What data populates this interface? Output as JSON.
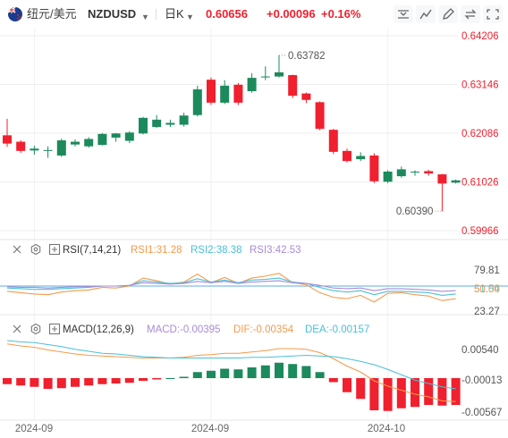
{
  "header": {
    "pair_cn": "纽元/美元",
    "symbol": "NZDUSD",
    "period": "日K",
    "price": "0.60656",
    "change": "+0.00096",
    "change_pct": "+0.16%"
  },
  "toolbar": {
    "icons": [
      "scale-icon",
      "draw-icon",
      "pencil-icon",
      "compare-icon",
      "fullscreen-icon"
    ]
  },
  "rsi": {
    "name": "RSI(7,14,21)",
    "rsi1": "RSI1:31.28",
    "rsi2": "RSI2:38.38",
    "rsi3": "RSI3:42.53"
  },
  "macd": {
    "name": "MACD(12,26,9)",
    "macd": "MACD:-0.00395",
    "dif": "DIF:-0.00354",
    "dea": "DEA:-0.00157"
  },
  "colors": {
    "up": "#1c8a5c",
    "down": "#f0202e",
    "rsi1": "#f59a4b",
    "rsi2": "#49c0d9",
    "rsi3": "#a98bd8",
    "dif": "#f59a4b",
    "dea": "#49c0d9",
    "grid": "#eeeeee"
  },
  "chart_data": [
    {
      "type": "candlestick",
      "title": "纽元/美元 NZDUSD 日K",
      "y_ticks": [
        "0.64206",
        "0.63146",
        "0.62086",
        "0.61026",
        "0.59966"
      ],
      "ylim": [
        0.59966,
        0.64206
      ],
      "x_ticks": [
        "2024-09",
        "2024-09",
        "2024-10"
      ],
      "annotations": {
        "high": "0.63782",
        "low": "0.60390"
      },
      "candles": [
        {
          "o": 0.6204,
          "h": 0.624,
          "l": 0.6179,
          "c": 0.6186
        },
        {
          "o": 0.619,
          "h": 0.6193,
          "l": 0.6166,
          "c": 0.617
        },
        {
          "o": 0.6171,
          "h": 0.6181,
          "l": 0.6162,
          "c": 0.6175
        },
        {
          "o": 0.6172,
          "h": 0.618,
          "l": 0.6155,
          "c": 0.6172
        },
        {
          "o": 0.616,
          "h": 0.6197,
          "l": 0.6157,
          "c": 0.6193
        },
        {
          "o": 0.6184,
          "h": 0.6195,
          "l": 0.618,
          "c": 0.619
        },
        {
          "o": 0.618,
          "h": 0.62,
          "l": 0.6177,
          "c": 0.6196
        },
        {
          "o": 0.6183,
          "h": 0.6209,
          "l": 0.6182,
          "c": 0.6207
        },
        {
          "o": 0.6199,
          "h": 0.6209,
          "l": 0.619,
          "c": 0.6208
        },
        {
          "o": 0.6192,
          "h": 0.6213,
          "l": 0.6187,
          "c": 0.621
        },
        {
          "o": 0.6208,
          "h": 0.6244,
          "l": 0.6206,
          "c": 0.6242
        },
        {
          "o": 0.6222,
          "h": 0.6248,
          "l": 0.622,
          "c": 0.6238
        },
        {
          "o": 0.6227,
          "h": 0.6238,
          "l": 0.6222,
          "c": 0.6231
        },
        {
          "o": 0.6227,
          "h": 0.6253,
          "l": 0.6223,
          "c": 0.6247
        },
        {
          "o": 0.6248,
          "h": 0.6312,
          "l": 0.6245,
          "c": 0.6304
        },
        {
          "o": 0.6325,
          "h": 0.633,
          "l": 0.627,
          "c": 0.6275
        },
        {
          "o": 0.6275,
          "h": 0.6324,
          "l": 0.6272,
          "c": 0.6312
        },
        {
          "o": 0.6314,
          "h": 0.6318,
          "l": 0.627,
          "c": 0.6275
        },
        {
          "o": 0.63,
          "h": 0.6339,
          "l": 0.6297,
          "c": 0.6329
        },
        {
          "o": 0.633,
          "h": 0.6354,
          "l": 0.6324,
          "c": 0.6332
        },
        {
          "o": 0.6332,
          "h": 0.6378,
          "l": 0.633,
          "c": 0.6341
        },
        {
          "o": 0.6335,
          "h": 0.6336,
          "l": 0.6285,
          "c": 0.629
        },
        {
          "o": 0.6295,
          "h": 0.6297,
          "l": 0.6274,
          "c": 0.6281
        },
        {
          "o": 0.6276,
          "h": 0.6278,
          "l": 0.6215,
          "c": 0.6218
        },
        {
          "o": 0.6216,
          "h": 0.6218,
          "l": 0.6163,
          "c": 0.6168
        },
        {
          "o": 0.617,
          "h": 0.6175,
          "l": 0.6145,
          "c": 0.6148
        },
        {
          "o": 0.6152,
          "h": 0.6167,
          "l": 0.6148,
          "c": 0.6159
        },
        {
          "o": 0.616,
          "h": 0.6165,
          "l": 0.61,
          "c": 0.6104
        },
        {
          "o": 0.6103,
          "h": 0.6128,
          "l": 0.61,
          "c": 0.6125
        },
        {
          "o": 0.6115,
          "h": 0.6136,
          "l": 0.6112,
          "c": 0.613
        },
        {
          "o": 0.6125,
          "h": 0.6128,
          "l": 0.6116,
          "c": 0.6125
        },
        {
          "o": 0.6126,
          "h": 0.6129,
          "l": 0.6116,
          "c": 0.6121
        },
        {
          "o": 0.6119,
          "h": 0.612,
          "l": 0.6039,
          "c": 0.6099
        },
        {
          "o": 0.6101,
          "h": 0.6108,
          "l": 0.6099,
          "c": 0.6106
        }
      ]
    },
    {
      "type": "line",
      "title": "RSI(7,14,21)",
      "y_ticks": [
        "79.81",
        "51.54",
        "50.00",
        "23.27"
      ],
      "series": [
        {
          "name": "RSI1",
          "values": [
            42,
            40,
            38,
            37,
            41,
            43,
            44,
            48,
            47,
            50,
            62,
            58,
            53,
            56,
            68,
            55,
            63,
            54,
            62,
            65,
            69,
            55,
            52,
            40,
            33,
            31,
            36,
            26,
            39,
            40,
            37,
            35,
            28,
            31
          ]
        },
        {
          "name": "RSI2",
          "values": [
            47,
            46,
            45,
            45,
            46,
            47,
            48,
            50,
            50,
            51,
            58,
            56,
            54,
            55,
            61,
            56,
            59,
            55,
            59,
            60,
            62,
            56,
            54,
            48,
            43,
            41,
            43,
            37,
            42,
            42,
            41,
            40,
            36,
            38
          ]
        },
        {
          "name": "RSI3",
          "values": [
            49,
            48,
            48,
            47,
            48,
            49,
            49,
            50,
            50,
            51,
            55,
            54,
            53,
            54,
            57,
            55,
            57,
            54,
            56,
            57,
            58,
            55,
            54,
            51,
            47,
            46,
            47,
            43,
            46,
            46,
            45,
            44,
            42,
            43
          ]
        }
      ]
    },
    {
      "type": "bar",
      "title": "MACD(12,26,9)",
      "y_ticks": [
        "0.00540",
        "-0.00013",
        "-0.00567"
      ],
      "series": [
        {
          "name": "MACD",
          "values": [
            -0.0009,
            -0.0011,
            -0.0013,
            -0.0016,
            -0.0015,
            -0.0013,
            -0.0011,
            -0.0009,
            -0.0008,
            -0.0007,
            -0.0004,
            -0.0002,
            0.0,
            0.0002,
            0.0009,
            0.0011,
            0.0014,
            0.0013,
            0.0016,
            0.0019,
            0.0023,
            0.0021,
            0.0018,
            0.0009,
            -0.0006,
            -0.0021,
            -0.0031,
            -0.0048,
            -0.0049,
            -0.0045,
            -0.0043,
            -0.004,
            -0.0041,
            -0.004
          ]
        },
        {
          "name": "DIF",
          "values": [
            0.0051,
            0.0048,
            0.0046,
            0.0042,
            0.0039,
            0.0036,
            0.0034,
            0.0033,
            0.0032,
            0.0031,
            0.003,
            0.003,
            0.003,
            0.0031,
            0.0034,
            0.0035,
            0.0037,
            0.0037,
            0.0039,
            0.0041,
            0.0044,
            0.0044,
            0.0043,
            0.0038,
            0.0029,
            0.0018,
            0.0009,
            -0.0004,
            -0.0012,
            -0.0018,
            -0.0024,
            -0.0028,
            -0.0034,
            -0.0035
          ]
        },
        {
          "name": "DEA",
          "values": [
            0.0056,
            0.0054,
            0.0053,
            0.005,
            0.0047,
            0.0043,
            0.004,
            0.0037,
            0.0036,
            0.0034,
            0.0032,
            0.0031,
            0.003,
            0.003,
            0.003,
            0.003,
            0.003,
            0.003,
            0.0031,
            0.0031,
            0.0032,
            0.0033,
            0.0034,
            0.0033,
            0.0032,
            0.0029,
            0.0025,
            0.002,
            0.0013,
            0.0005,
            -0.0003,
            -0.0008,
            -0.0013,
            -0.0016
          ]
        }
      ]
    }
  ]
}
